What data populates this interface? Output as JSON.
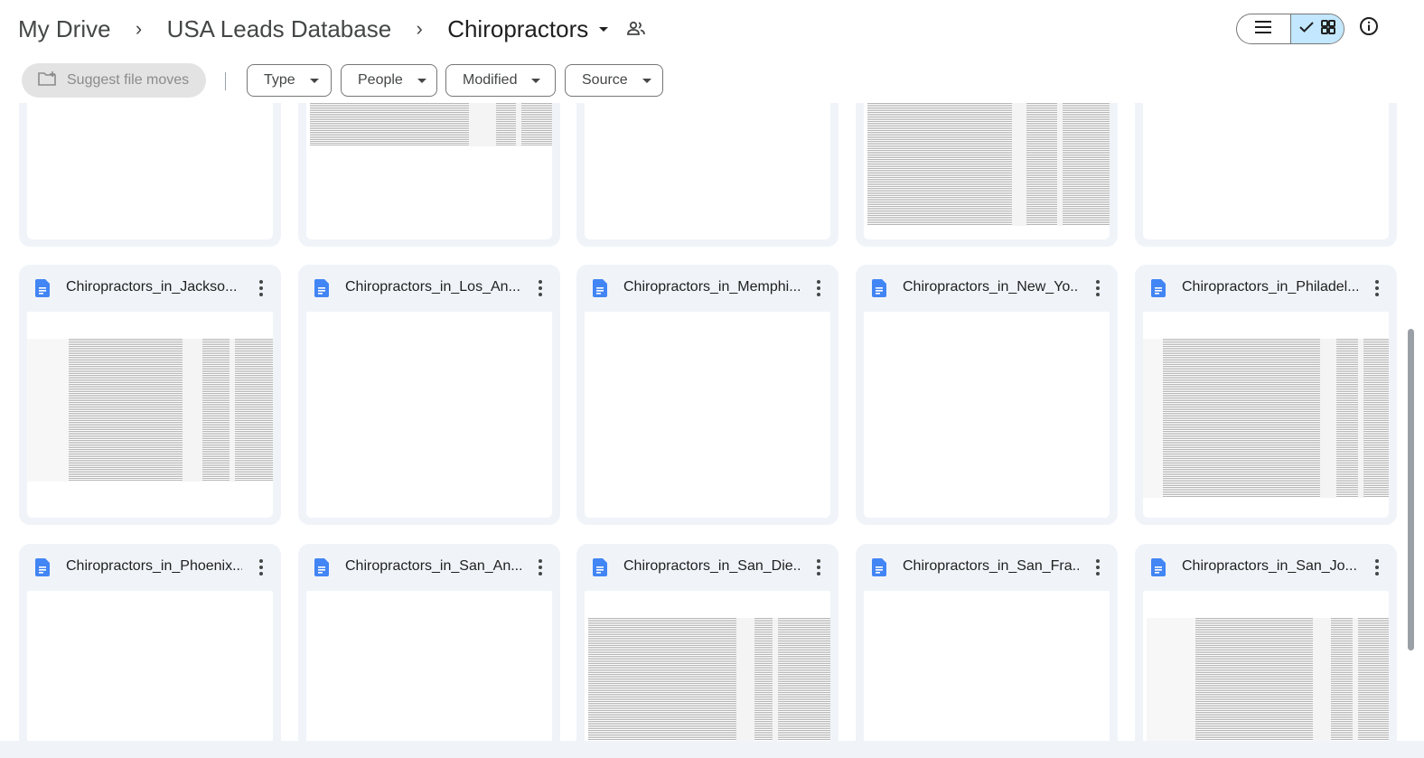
{
  "breadcrumb": {
    "root": "My Drive",
    "parent": "USA Leads Database",
    "current": "Chiropractors",
    "separator": "›"
  },
  "view_toggle": {
    "list_icon": "list-view-icon",
    "grid_icon": "grid-view-icon",
    "selected": "grid"
  },
  "info_icon": "info-icon",
  "filters": {
    "suggest_label": "Suggest file moves",
    "chips": [
      "Type",
      "People",
      "Modified",
      "Source"
    ]
  },
  "top_row": [
    {
      "thumb": "blank"
    },
    {
      "thumb": "sheet"
    },
    {
      "thumb": "blank"
    },
    {
      "thumb": "sheet"
    },
    {
      "thumb": "blank"
    }
  ],
  "files": [
    {
      "title": "Chiropractors_in_Jackso...",
      "thumb": "sheet"
    },
    {
      "title": "Chiropractors_in_Los_An...",
      "thumb": "blank"
    },
    {
      "title": "Chiropractors_in_Memphi...",
      "thumb": "blank"
    },
    {
      "title": "Chiropractors_in_New_Yo...",
      "thumb": "blank"
    },
    {
      "title": "Chiropractors_in_Philadel...",
      "thumb": "sheet"
    },
    {
      "title": "Chiropractors_in_Phoenix...",
      "thumb": "blank"
    },
    {
      "title": "Chiropractors_in_San_An...",
      "thumb": "blank"
    },
    {
      "title": "Chiropractors_in_San_Die...",
      "thumb": "sheet"
    },
    {
      "title": "Chiropractors_in_San_Fra...",
      "thumb": "blank"
    },
    {
      "title": "Chiropractors_in_San_Jo...",
      "thumb": "sheet"
    }
  ],
  "colors": {
    "accent": "#c2e7ff",
    "doc_blue": "#4285f4",
    "card_bg": "#f0f4f9"
  }
}
